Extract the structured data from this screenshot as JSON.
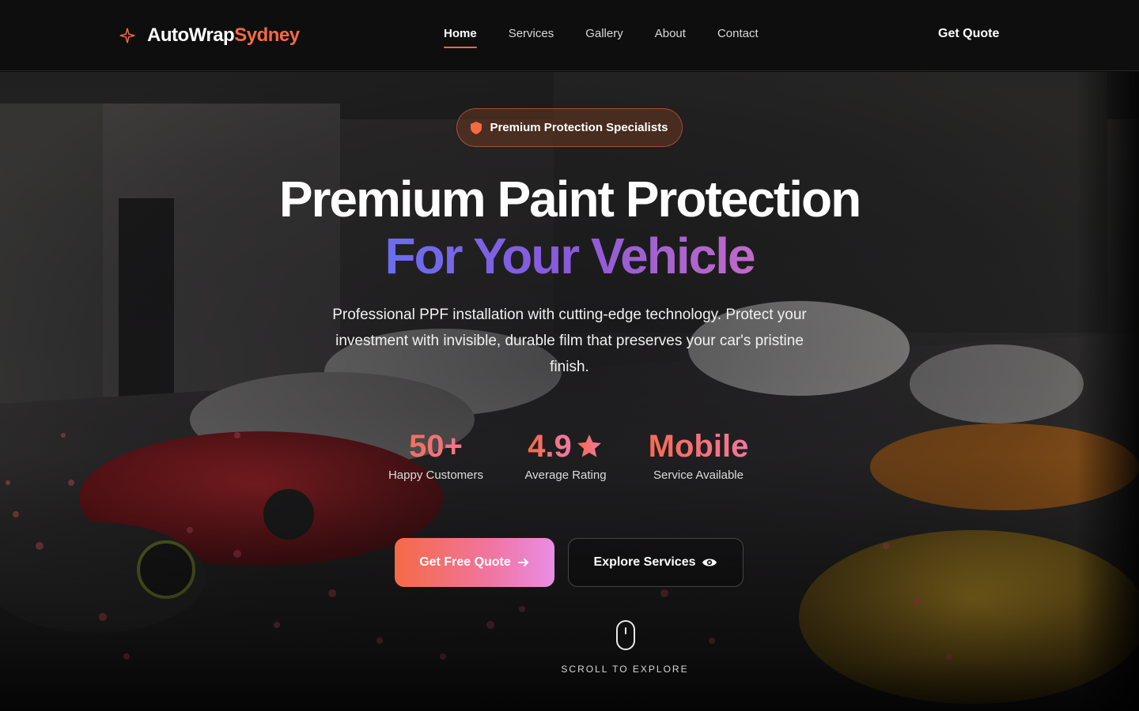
{
  "nav": {
    "brand_primary": "AutoWrap",
    "brand_accent": "Sydney",
    "links": [
      {
        "label": "Home",
        "active": true
      },
      {
        "label": "Services",
        "active": false
      },
      {
        "label": "Gallery",
        "active": false
      },
      {
        "label": "About",
        "active": false
      },
      {
        "label": "Contact",
        "active": false
      }
    ],
    "cta_label": "Get Quote"
  },
  "hero": {
    "badge": "Premium Protection Specialists",
    "title_line1": "Premium Paint Protection",
    "title_line2": "For Your Vehicle",
    "lead": "Professional PPF installation with cutting-edge technology. Protect your investment with invisible, durable film that preserves your car's pristine finish.",
    "stats": [
      {
        "value": "50+",
        "label": "Happy Customers"
      },
      {
        "value": "4.9",
        "label": "Average Rating",
        "icon": "star-icon"
      },
      {
        "value": "Mobile",
        "label": "Service Available"
      }
    ],
    "primary_button": "Get Free Quote",
    "secondary_button": "Explore Services",
    "scroll_hint": "SCROLL TO EXPLORE"
  },
  "colors": {
    "accent": "#f56a44",
    "gradient_purple": "#6b6df0",
    "gradient_pink": "#e98de6",
    "nav_bg": "#0e0e0e"
  }
}
